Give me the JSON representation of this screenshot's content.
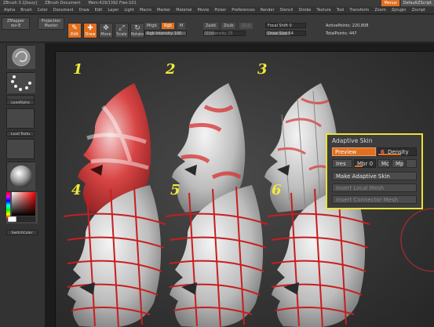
{
  "titlebar": {
    "app": "ZBrush 3.1[kavy]",
    "doc": "ZBrush Document",
    "mem": "Mem:419/1392 Free:101",
    "menu_btn": "Menus",
    "script_btn": "DefaultZScript"
  },
  "menubar": [
    "Alpha",
    "Brush",
    "Color",
    "Document",
    "Draw",
    "Edit",
    "Layer",
    "Light",
    "Macro",
    "Marker",
    "Material",
    "Movie",
    "Picker",
    "Preferences",
    "Render",
    "Stencil",
    "Stroke",
    "Texture",
    "Tool",
    "Transform",
    "Zoom",
    "Zplugin",
    "Zscript"
  ],
  "toolbar": {
    "zmapper": "ZMapper",
    "zmapper_sub": "rev-E",
    "projection": "Projection",
    "projection_sub": "Master",
    "edit": "Edit",
    "draw": "Draw",
    "move": "Move",
    "scale": "Scale",
    "rotate": "Rotate",
    "mrgb": "Mrgb",
    "rgb": "Rgb",
    "m": "M",
    "rgb_intensity_label": "Rgb Intensity",
    "rgb_intensity_value": "100",
    "zadd": "Zadd",
    "zsub": "Zsub",
    "zcut": "Zcut",
    "z_intensity_label": "Z Intensity",
    "z_intensity_value": "25",
    "focal_shift_label": "Focal Shift",
    "focal_shift_value": "0",
    "draw_size_label": "Draw Size",
    "draw_size_value": "64",
    "active_points_label": "ActivePoints:",
    "active_points_value": "220,808",
    "total_points_label": "TotalPoints:",
    "total_points_value": "447"
  },
  "shelf": {
    "load_alpha": "LoadAlpha",
    "load_tex": "Load Textu",
    "switch_color": "SwitchColor"
  },
  "stages": [
    "1",
    "2",
    "3",
    "4",
    "5",
    "6"
  ],
  "adaptive_skin": {
    "title": "Adaptive Skin",
    "preview": "Preview",
    "density_value": "6",
    "density_label": "Density",
    "ires": "Ires",
    "mbr_label": "Mbr",
    "mbr_value": "0",
    "mc": "Mc",
    "mp": "Mp",
    "make": "Make Adaptive Skin",
    "insert_local": "Insert Local Mesh",
    "insert_connector": "Insert Connector Mesh"
  },
  "colors": {
    "accent": "#e07020",
    "highlight_yellow": "#e8e23a",
    "panel": "#3d3d3d"
  }
}
